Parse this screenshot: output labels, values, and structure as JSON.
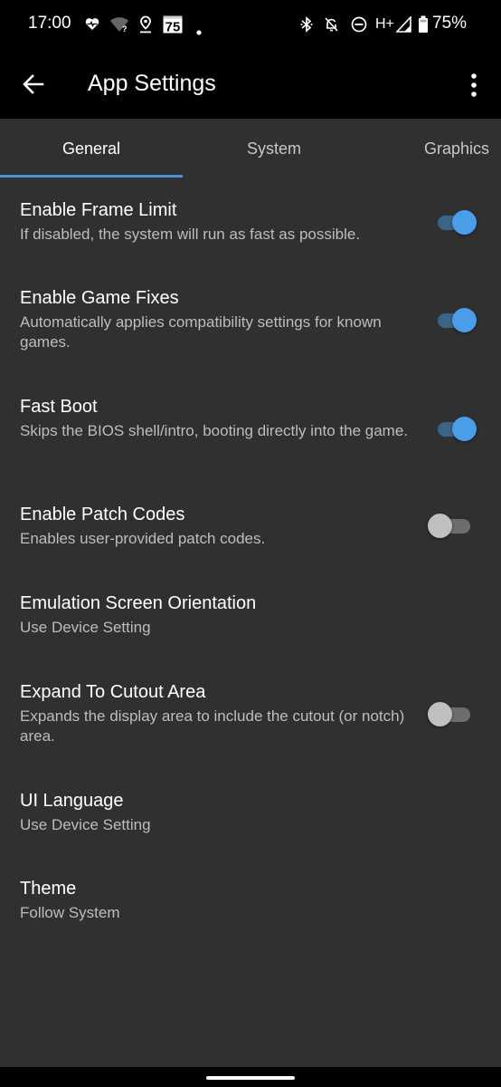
{
  "status_bar": {
    "time": "17:00",
    "left_icons": [
      "heart-monitor-icon",
      "wifi-unknown-icon",
      "location-icon",
      "calendar-75-icon",
      "notification-dot-icon"
    ],
    "calendar_badge": "75",
    "network_label": "H+",
    "right_icons": [
      "bluetooth-icon",
      "bell-off-icon",
      "do-not-disturb-icon",
      "network-type-icon",
      "cell-signal-icon",
      "battery-icon"
    ],
    "battery_percent": "75%"
  },
  "app_bar": {
    "title": "App Settings",
    "back_icon": "arrow-back-icon",
    "overflow_icon": "more-vert-icon"
  },
  "tabs": [
    {
      "label": "General",
      "active": true
    },
    {
      "label": "System",
      "active": false
    },
    {
      "label": "Graphics",
      "active": false
    }
  ],
  "accent_color": "#4a9de8",
  "preferences": [
    {
      "title": "Enable Frame Limit",
      "summary": "If disabled, the system will run as fast as possible.",
      "type": "switch",
      "checked": true
    },
    {
      "title": "Enable Game Fixes",
      "summary": "Automatically applies compatibility settings for known games.",
      "type": "switch",
      "checked": true
    },
    {
      "title": "Fast Boot",
      "summary": "Skips the BIOS shell/intro, booting directly into the game.",
      "type": "switch",
      "checked": true
    },
    {
      "title": "Enable Patch Codes",
      "summary": "Enables user-provided patch codes.",
      "type": "switch",
      "checked": false
    },
    {
      "title": "Emulation Screen Orientation",
      "summary": "Use Device Setting",
      "type": "list"
    },
    {
      "title": "Expand To Cutout Area",
      "summary": "Expands the display area to include the cutout (or notch) area.",
      "type": "switch",
      "checked": false
    },
    {
      "title": "UI Language",
      "summary": "Use Device Setting",
      "type": "list"
    },
    {
      "title": "Theme",
      "summary": "Follow System",
      "type": "list"
    }
  ]
}
